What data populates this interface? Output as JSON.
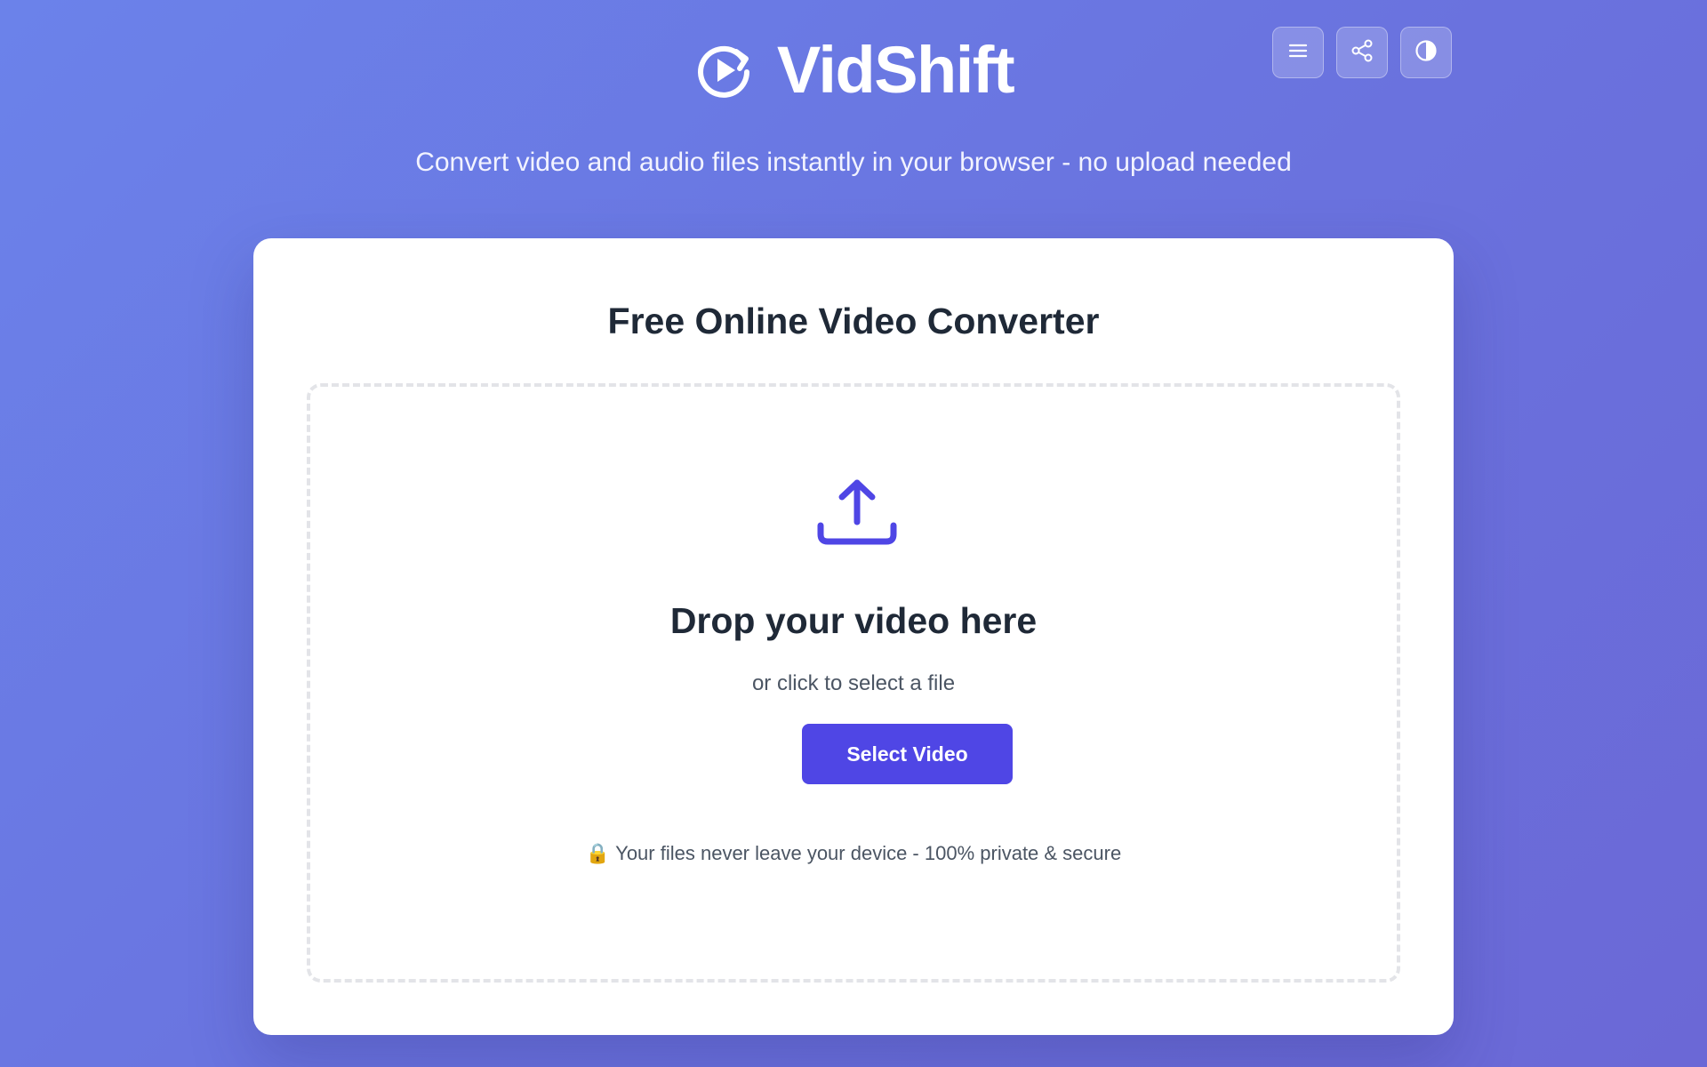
{
  "header": {
    "brand_name": "VidShift",
    "subtitle": "Convert video and audio files instantly in your browser - no upload needed",
    "logo_icon": "replay-play-icon",
    "actions": [
      {
        "icon": "menu-icon",
        "label": "Menu"
      },
      {
        "icon": "share-icon",
        "label": "Share"
      },
      {
        "icon": "contrast-icon",
        "label": "Toggle theme"
      }
    ]
  },
  "card": {
    "title": "Free Online Video Converter",
    "dropzone": {
      "icon": "upload-icon",
      "title": "Drop your video here",
      "subtitle": "or click to select a file",
      "button_label": "Select Video",
      "privacy_icon": "🔒",
      "privacy_text": "Your files never leave your device - 100% private & secure"
    }
  },
  "colors": {
    "background_start": "#6b82ea",
    "background_end": "#6b68d6",
    "accent": "#4f46e5",
    "heading": "#1f2937",
    "muted_text": "#4b5563"
  }
}
